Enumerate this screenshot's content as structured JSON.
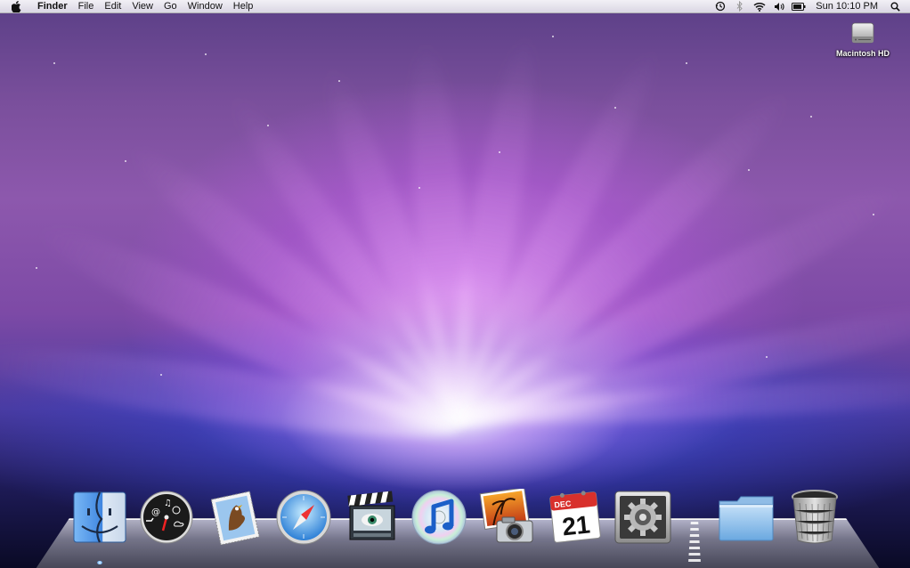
{
  "menubar": {
    "app_name": "Finder",
    "items": [
      "File",
      "Edit",
      "View",
      "Go",
      "Window",
      "Help"
    ],
    "status_icons": [
      "time-machine-icon",
      "bluetooth-icon",
      "wifi-icon",
      "volume-icon",
      "battery-icon"
    ],
    "clock": "Sun 10:10 PM",
    "spotlight_icon": "spotlight-search-icon"
  },
  "desktop": {
    "icons": [
      {
        "label": "Macintosh HD",
        "icon": "hard-drive-icon"
      }
    ]
  },
  "dock": {
    "items": [
      {
        "name": "Finder",
        "icon": "finder-icon",
        "running": true
      },
      {
        "name": "Dashboard",
        "icon": "dashboard-icon",
        "running": false
      },
      {
        "name": "Mail",
        "icon": "mail-icon",
        "running": false
      },
      {
        "name": "Safari",
        "icon": "safari-icon",
        "running": false
      },
      {
        "name": "Front Row",
        "icon": "front-row-icon",
        "running": false
      },
      {
        "name": "iTunes",
        "icon": "itunes-icon",
        "running": false
      },
      {
        "name": "iPhoto",
        "icon": "iphoto-icon",
        "running": false
      },
      {
        "name": "iCal",
        "icon": "ical-icon",
        "running": false
      },
      {
        "name": "System Preferences",
        "icon": "system-preferences-icon",
        "running": false
      },
      {
        "name": "Documents",
        "icon": "folder-icon",
        "running": false
      },
      {
        "name": "Trash",
        "icon": "trash-icon",
        "running": false
      }
    ],
    "ical": {
      "month": "DEC",
      "day": "21"
    }
  },
  "colors": {
    "menubar_bg": "#ececf0",
    "wallpaper_accent": "#b45ce0",
    "wallpaper_glow": "#f4d8ff",
    "dock_blue": "#4a90e2"
  }
}
